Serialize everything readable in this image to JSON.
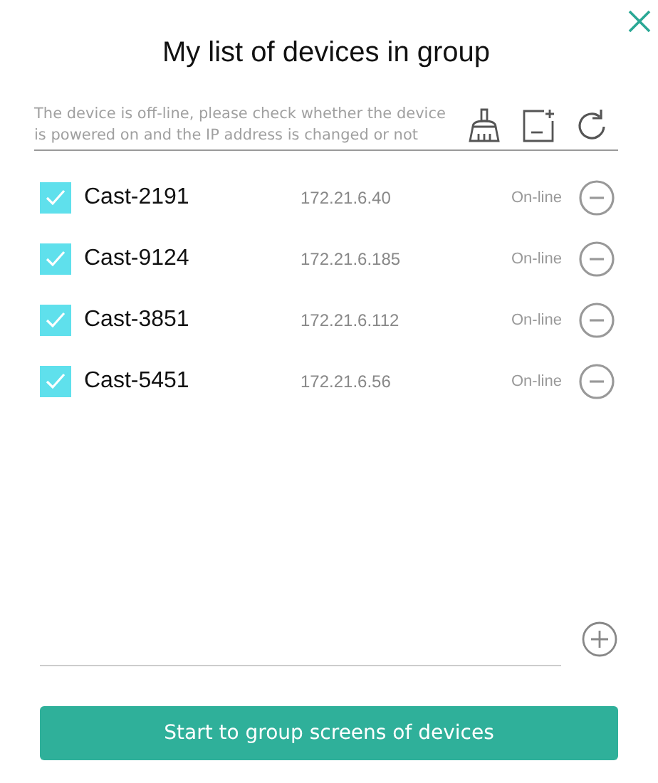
{
  "dialog": {
    "title": "My list of devices in group"
  },
  "notice": "The device is off-line, please check whether the device is powered on and the IP address is changed or not",
  "devices": [
    {
      "name": "Cast-2191",
      "ip": "172.21.6.40",
      "status": "On-line",
      "checked": true
    },
    {
      "name": "Cast-9124",
      "ip": "172.21.6.185",
      "status": "On-line",
      "checked": true
    },
    {
      "name": "Cast-3851",
      "ip": "172.21.6.112",
      "status": "On-line",
      "checked": true
    },
    {
      "name": "Cast-5451",
      "ip": "172.21.6.56",
      "status": "On-line",
      "checked": true
    }
  ],
  "start_button": "Start to group screens of devices"
}
